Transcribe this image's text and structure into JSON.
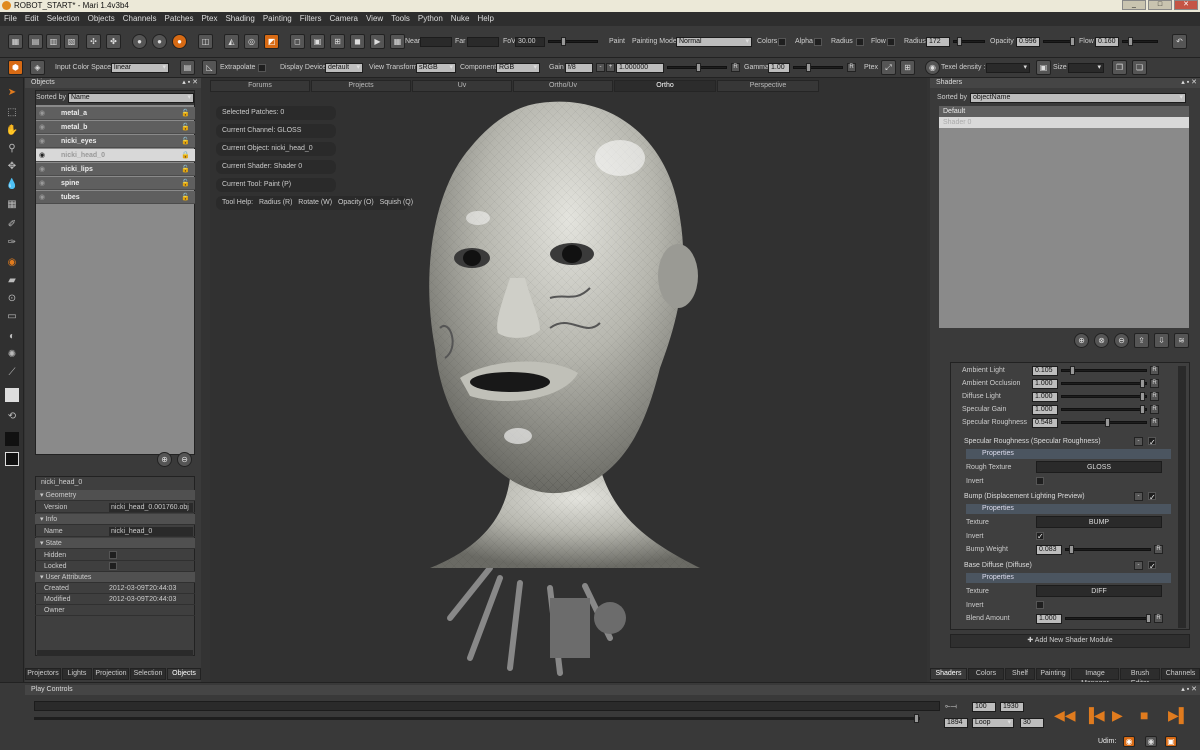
{
  "window": {
    "title": "ROBOT_START* - Mari 1.4v3b4"
  },
  "menu": [
    "File",
    "Edit",
    "Selection",
    "Objects",
    "Channels",
    "Patches",
    "Ptex",
    "Shading",
    "Painting",
    "Filters",
    "Camera",
    "View",
    "Tools",
    "Python",
    "Nuke",
    "Help"
  ],
  "toolbar1": {
    "near_label": "Near",
    "far_label": "Far",
    "fov_label": "FoV",
    "fov_value": "30.00",
    "paint_label": "Paint",
    "painting_mode_label": "Painting Mode",
    "painting_mode_value": "Normal",
    "colors_label": "Colors",
    "alpha_label": "Alpha",
    "radius_check_label": "Radius",
    "flow_check_label": "Flow",
    "radius_label": "Radius",
    "radius_value": "172",
    "opacity_label": "Opacity",
    "opacity_value": "0.996",
    "flow_label": "Flow",
    "flow_value": "0.160"
  },
  "toolbar2": {
    "input_color_space_label": "Input Color Space",
    "input_color_space_value": "linear",
    "extrapolate_label": "Extrapolate",
    "display_device_label": "Display Device",
    "display_device_value": "default",
    "view_transform_label": "View Transform",
    "view_transform_value": "sRGB",
    "component_label": "Component",
    "component_value": "RGB",
    "gain_label": "Gain",
    "gain_value": "f/8",
    "gain_number": "1.000000",
    "gamma_label": "Gamma",
    "gamma_value": "1.00",
    "r_label": "R",
    "ptex_label": "Ptex",
    "texel_density_label": "Texel density :",
    "size_label": "Size :"
  },
  "objects": {
    "title": "Objects",
    "sorted_by_label": "Sorted by",
    "sorted_by_value": "Name",
    "items": [
      {
        "name": "metal_a"
      },
      {
        "name": "metal_b"
      },
      {
        "name": "nicki_eyes"
      },
      {
        "name": "nicki_head_0",
        "selected": true
      },
      {
        "name": "nicki_lips"
      },
      {
        "name": "spine"
      },
      {
        "name": "tubes"
      }
    ],
    "properties": {
      "object_name": "nicki_head_0",
      "geometry": "Geometry",
      "version_label": "Version",
      "version_value": "nicki_head_0.001760.obj",
      "info": "Info",
      "name_label": "Name",
      "name_value": "nicki_head_0",
      "state": "State",
      "hidden_label": "Hidden",
      "locked_label": "Locked",
      "user_attributes": "User Attributes",
      "created_label": "Created",
      "created_value": "2012-03-09T20:44:03",
      "modified_label": "Modified",
      "modified_value": "2012-03-09T20:44:03",
      "owner_label": "Owner"
    },
    "bottom_tabs": [
      "Projectors",
      "Lights",
      "Projection",
      "Selection ...",
      "Objects"
    ]
  },
  "viewport": {
    "tabs": [
      "Forums",
      "Projects",
      "Uv",
      "Ortho/Uv",
      "Ortho",
      "Perspective"
    ],
    "active_tab": "Ortho",
    "hud": {
      "selected_patches": "Selected Patches: 0",
      "current_channel": "Current Channel: GLOSS",
      "current_object": "Current Object: nicki_head_0",
      "current_shader": "Current Shader: Shader 0",
      "current_tool": "Current Tool: Paint (P)",
      "tool_help": "Tool Help:",
      "radius": "Radius (R)",
      "rotate": "Rotate (W)",
      "opacity": "Opacity (O)",
      "squish": "Squish (Q)"
    }
  },
  "shaders": {
    "title": "Shaders",
    "sorted_by_label": "Sorted by",
    "sorted_by_value": "objectName",
    "items": [
      "Default",
      "Shader 0"
    ],
    "lighting": [
      {
        "label": "Ambient Light",
        "value": "0.105",
        "level": 0.1
      },
      {
        "label": "Ambient Occlusion",
        "value": "1.000",
        "level": 1.0
      },
      {
        "label": "Diffuse Light",
        "value": "1.000",
        "level": 1.0
      },
      {
        "label": "Specular Gain",
        "value": "1.000",
        "level": 1.0
      },
      {
        "label": "Specular Roughness",
        "value": "0.548",
        "level": 0.55
      }
    ],
    "modules": [
      {
        "title": "Specular Roughness (Specular Roughness)",
        "properties": "Properties",
        "rows": [
          {
            "label": "Rough Texture",
            "texture": "GLOSS"
          },
          {
            "label": "Invert",
            "checked": false
          }
        ]
      },
      {
        "title": "Bump (Displacement Lighting Preview)",
        "properties": "Properties",
        "rows": [
          {
            "label": "Texture",
            "texture": "BUMP"
          },
          {
            "label": "Invert",
            "checked": true
          },
          {
            "label": "Bump Weight",
            "value": "0.083"
          }
        ]
      },
      {
        "title": "Base Diffuse (Diffuse)",
        "properties": "Properties",
        "rows": [
          {
            "label": "Texture",
            "texture": "DIFF"
          },
          {
            "label": "Invert",
            "checked": false
          },
          {
            "label": "Blend Amount",
            "value": "1.000"
          }
        ]
      }
    ],
    "add_module": "Add New Shader Module",
    "bottom_tabs": [
      "Shaders",
      "Colors",
      "Shelf",
      "Painting",
      "Image Manager",
      "Brush Editor",
      "Channels"
    ]
  },
  "play": {
    "title": "Play Controls",
    "start": "100",
    "end": "1930",
    "current": "1894",
    "loop": "Loop",
    "fps": "30"
  },
  "status": {
    "udim_label": "Udim:"
  }
}
